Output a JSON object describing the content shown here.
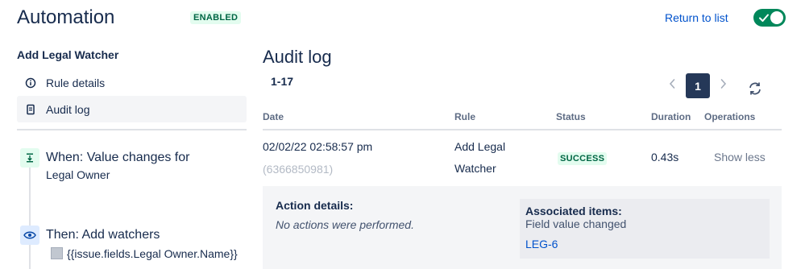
{
  "header": {
    "title": "Automation",
    "status_badge": "ENABLED",
    "return_link": "Return to list",
    "toggle_on": true
  },
  "sidebar": {
    "rule_name": "Add Legal Watcher",
    "items": [
      {
        "label": "Rule details",
        "icon": "info-icon",
        "active": false
      },
      {
        "label": "Audit log",
        "icon": "document-icon",
        "active": true
      }
    ],
    "flow": {
      "when_title": "When: Value changes for",
      "when_sub": "Legal Owner",
      "then_title": "Then: Add watchers",
      "then_sub": "{{issue.fields.Legal Owner.Name}}"
    }
  },
  "main": {
    "title": "Audit log",
    "range": "1-17",
    "pagination": {
      "current_page": "1",
      "prev": "‹",
      "next": "›"
    },
    "columns": [
      "Date",
      "Rule",
      "Status",
      "Duration",
      "Operations"
    ],
    "rows": [
      {
        "date": "02/02/22 02:58:57 pm",
        "id": "(6366850981)",
        "rule_line1": "Add Legal",
        "rule_line2": "Watcher",
        "status": "SUCCESS",
        "duration": "0.43s",
        "operation": "Show less"
      }
    ],
    "details": {
      "action_label": "Action details:",
      "action_value": "No actions were performed.",
      "assoc_label": "Associated items:",
      "assoc_value": "Field value changed",
      "assoc_link": "LEG-6"
    }
  },
  "colors": {
    "accent": "#0052cc",
    "toggle": "#00875a",
    "success_bg": "#e3fcef",
    "success_text": "#006644",
    "page_active": "#253858"
  }
}
